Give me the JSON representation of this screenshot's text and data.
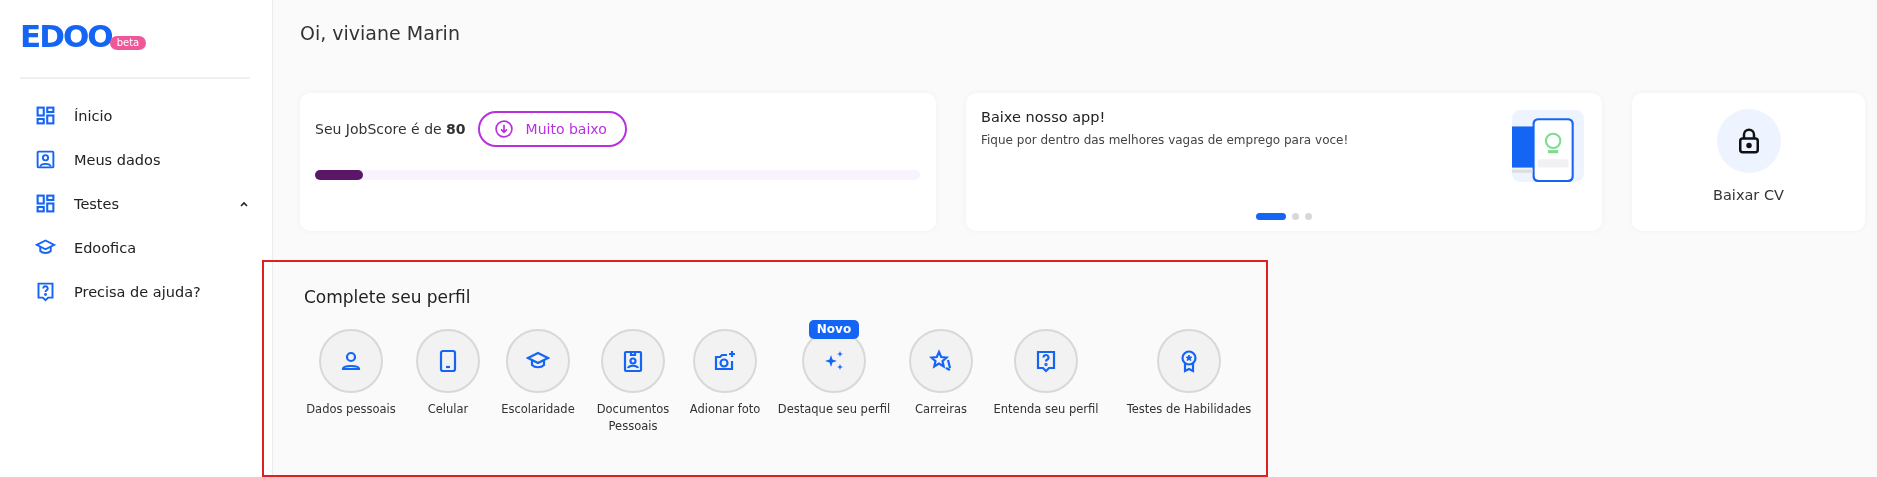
{
  "logo": {
    "text": "EDOO",
    "badge": "beta"
  },
  "sidebar": {
    "items": [
      {
        "label": "Ínicio"
      },
      {
        "label": "Meus dados"
      },
      {
        "label": "Testes",
        "expanded": true
      },
      {
        "label": "Edoofica"
      },
      {
        "label": "Precisa de ajuda?"
      }
    ]
  },
  "greeting": "Oi, viviane Marin",
  "jobscore": {
    "text": "Seu JobScore é de **80**",
    "badge": "Muito baixo",
    "level": 0.08
  },
  "app_card": {
    "title": "Baixe nosso app!",
    "text": "Fique por dentro das melhores vagas de emprego para voce!",
    "slides": [
      {
        "selected": true
      },
      {
        "selected": false
      },
      {
        "selected": false
      }
    ]
  },
  "cv_card": {
    "label": "Baixar CV"
  },
  "profile": {
    "title": "Complete seu perfil",
    "items": [
      {
        "label": "Dados pessoais"
      },
      {
        "label": "Celular"
      },
      {
        "label": "Escolaridade"
      },
      {
        "label": "Documentos Pessoais"
      },
      {
        "label": "Adionar foto"
      },
      {
        "label": "Destaque seu perfil",
        "tag": "Novo"
      },
      {
        "label": "Carreiras"
      },
      {
        "label": "Entenda seu perfil"
      },
      {
        "label": "Testes de Habilidades"
      }
    ]
  }
}
